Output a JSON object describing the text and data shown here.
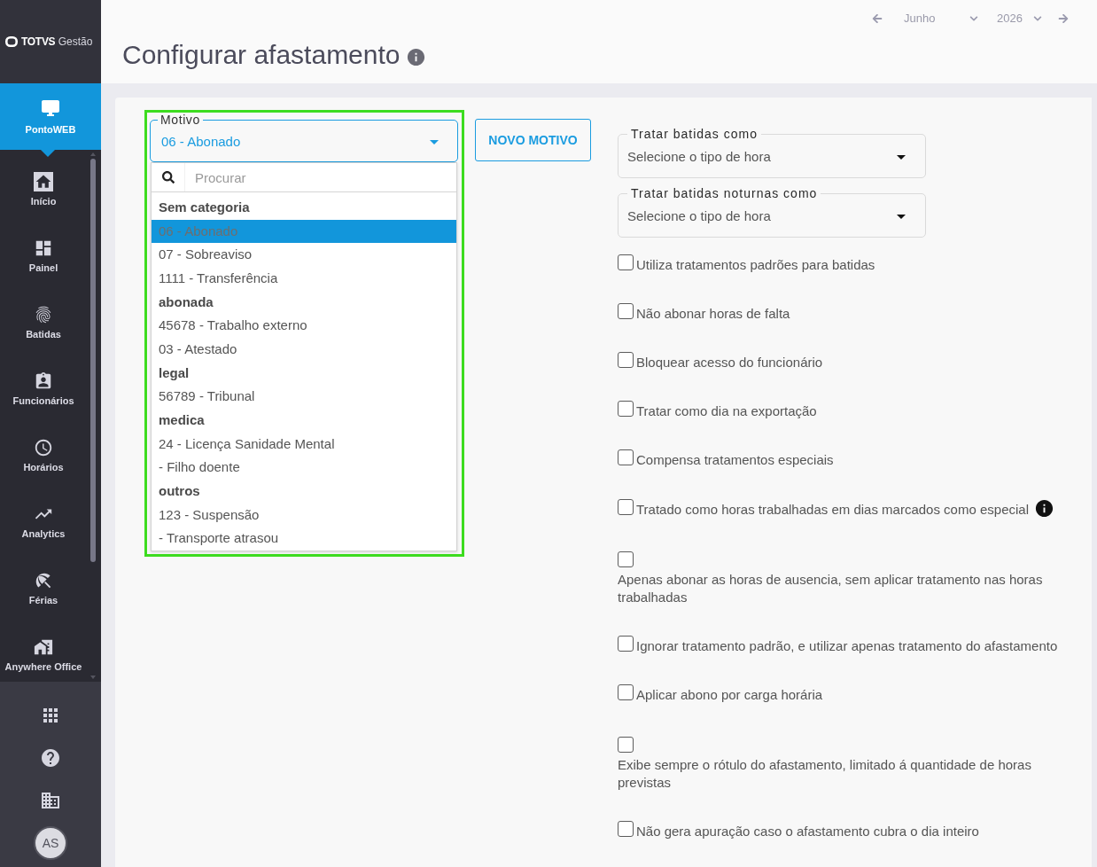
{
  "sidebar": {
    "logo": {
      "brand": "TOTVS",
      "product": "Gestão"
    },
    "module": {
      "label": "PontoWEB",
      "selected": true
    },
    "items": [
      {
        "label": "Início",
        "selected": false
      },
      {
        "label": "Painel",
        "selected": false
      },
      {
        "label": "Batidas",
        "selected": false
      },
      {
        "label": "Funcionários",
        "selected": false
      },
      {
        "label": "Horários",
        "selected": false
      },
      {
        "label": "Analytics",
        "selected": false
      },
      {
        "label": "Férias",
        "selected": false
      },
      {
        "label": "Anywhere Office",
        "selected": false
      }
    ],
    "avatar": "AS"
  },
  "header": {
    "title": "Configurar afastamento",
    "month": "Junho",
    "year": "2026"
  },
  "motivo": {
    "label": "Motivo",
    "value": "06 - Abonado",
    "expanded": true,
    "search_placeholder": "Procurar",
    "groups": [
      {
        "name": "Sem categoria",
        "options": [
          {
            "label": "06 - Abonado",
            "selected": true
          },
          {
            "label": "07 - Sobreaviso",
            "selected": false
          },
          {
            "label": "1111 - Transferência",
            "selected": false
          }
        ]
      },
      {
        "name": "abonada",
        "options": [
          {
            "label": "45678 - Trabalho externo",
            "selected": false
          },
          {
            "label": "03 - Atestado",
            "selected": false
          }
        ]
      },
      {
        "name": "legal",
        "options": [
          {
            "label": "56789 - Tribunal",
            "selected": false
          }
        ]
      },
      {
        "name": "medica",
        "options": [
          {
            "label": "24 - Licença Sanidade Mental",
            "selected": false
          },
          {
            "label": "- Filho doente",
            "selected": false
          }
        ]
      },
      {
        "name": "outros",
        "options": [
          {
            "label": "123 - Suspensão",
            "selected": false
          },
          {
            "label": "- Transporte atrasou",
            "selected": false
          }
        ]
      }
    ]
  },
  "new_button": "NOVO MOTIVO",
  "selects": [
    {
      "label": "Tratar batidas como",
      "placeholder": "Selecione o tipo de hora"
    },
    {
      "label": "Tratar batidas noturnas como",
      "placeholder": "Selecione o tipo de hora"
    }
  ],
  "checkboxes": [
    {
      "kind": "inline",
      "label": "Utiliza tratamentos padrões para batidas",
      "checked": false,
      "info": false
    },
    {
      "kind": "inline",
      "label": "Não abonar horas de falta",
      "checked": false,
      "info": false
    },
    {
      "kind": "inline",
      "label": "Bloquear acesso do funcionário",
      "checked": false,
      "info": false
    },
    {
      "kind": "inline",
      "label": "Tratar como dia na exportação",
      "checked": false,
      "info": false
    },
    {
      "kind": "inline",
      "label": "Compensa tratamentos especiais",
      "checked": false,
      "info": false
    },
    {
      "kind": "inline",
      "label": "Tratado como horas trabalhadas em dias marcados como especial",
      "checked": false,
      "info": true
    },
    {
      "kind": "stacked",
      "label": "Apenas abonar as horas de ausencia, sem aplicar tratamento nas horas trabalhadas",
      "checked": false,
      "info": false
    },
    {
      "kind": "inline",
      "label": "Ignorar tratamento padrão, e utilizar apenas tratamento do afastamento",
      "checked": false,
      "info": false
    },
    {
      "kind": "inline",
      "label": "Aplicar abono por carga horária",
      "checked": false,
      "info": false
    },
    {
      "kind": "stacked",
      "label": "Exibe sempre o rótulo do afastamento, limitado á quantidade de horas previstas",
      "checked": false,
      "info": false
    },
    {
      "kind": "inline",
      "label": "Não gera apuração caso o afastamento cubra o dia inteiro",
      "checked": false,
      "info": false
    }
  ]
}
